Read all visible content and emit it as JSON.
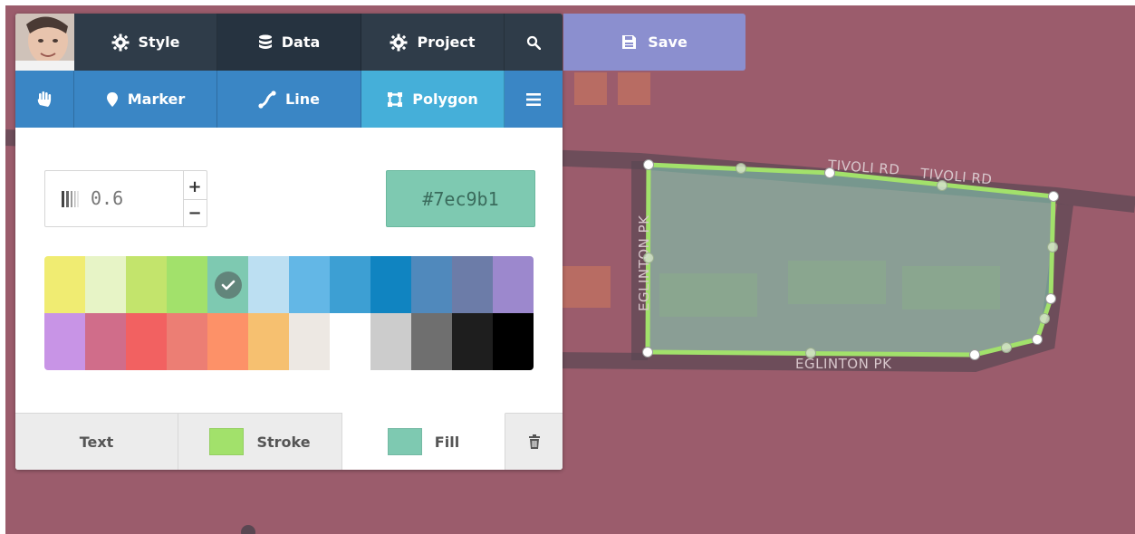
{
  "toolbar": {
    "style_label": "Style",
    "data_label": "Data",
    "project_label": "Project",
    "save_label": "Save",
    "marker_label": "Marker",
    "line_label": "Line",
    "polygon_label": "Polygon"
  },
  "icons": {
    "style": "gear-icon",
    "data": "database-icon",
    "project": "gear-icon",
    "search": "search-icon",
    "save": "floppy-disk-icon",
    "pan": "hand-icon",
    "marker": "map-pin-icon",
    "line": "line-draw-icon",
    "polygon": "polygon-icon",
    "menu": "hamburger-menu-icon",
    "delete": "trash-icon"
  },
  "editor": {
    "opacity_value": "0.6",
    "plus_label": "+",
    "minus_label": "−",
    "color_hex": "#7ec9b1",
    "selected_swatch_index": 4,
    "palette": [
      "#f0ec72",
      "#e7f4c6",
      "#c3e46c",
      "#a2e16b",
      "#7ec9b1",
      "#bcdff2",
      "#63b7e6",
      "#3d9fd3",
      "#1084c1",
      "#5089bc",
      "#6c7ca8",
      "#9c88cd",
      "#c894e6",
      "#d06d8a",
      "#f26161",
      "#ec7e74",
      "#fd9168",
      "#f6c070",
      "#ede8e3",
      "#ffffff",
      "#cccccc",
      "#6f6f6f",
      "#1e1e1e",
      "#000000"
    ]
  },
  "tabs": {
    "text_label": "Text",
    "stroke_label": "Stroke",
    "stroke_color": "#a2e16b",
    "fill_label": "Fill",
    "fill_color": "#7ec9b1"
  },
  "map": {
    "background_color": "#9b5c6c",
    "streets": [
      "TIVOLI RD",
      "TIVOLI RD",
      "EGLINTON PK",
      "EGLINTON PK"
    ],
    "polygon_stroke_color": "#a2e16b",
    "polygon_fill_color": "#7ec9b1",
    "polygon_fill_opacity": 0.6
  }
}
